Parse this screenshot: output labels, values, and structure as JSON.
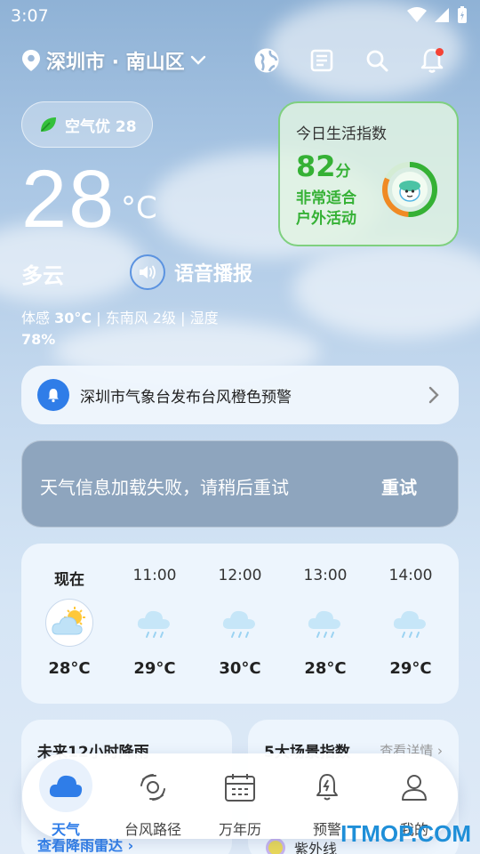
{
  "status_bar": {
    "time": "3:07",
    "icons": [
      "wifi-icon",
      "signal-icon",
      "battery-icon"
    ]
  },
  "location": {
    "name": "深圳市 · 南山区",
    "icon": "location-pin-icon"
  },
  "toolbar_icons": [
    "globe-icon",
    "news-icon",
    "search-icon",
    "bell-icon"
  ],
  "air_quality": {
    "label": "空气优 28",
    "icon": "leaf-icon"
  },
  "current": {
    "temperature": "28",
    "unit": "°C",
    "condition": "多云",
    "voice_label": "语音播报",
    "feels_label": "体感",
    "feels_value": "30°C",
    "sep1": "|",
    "wind": "东南风 2级",
    "sep2": "|",
    "humidity_label": "湿度",
    "humidity_value": "78%"
  },
  "life_index": {
    "title": "今日生活指数",
    "score": "82",
    "score_unit": "分",
    "desc_line1": "非常适合",
    "desc_line2": "户外活动",
    "gauge_fraction": 0.82,
    "colors": {
      "accent": "#35b135",
      "gauge_orange": "#f08a24"
    }
  },
  "alert": {
    "text": "深圳市气象台发布台风橙色预警",
    "icon": "bell-alert-icon"
  },
  "load_error": {
    "message": "天气信息加载失败，请稍后重试",
    "retry": "重试"
  },
  "hourly": [
    {
      "time": "现在",
      "temp": "28°C",
      "icon": "partly-cloudy-icon"
    },
    {
      "time": "11:00",
      "temp": "29°C",
      "icon": "cloud-rain-icon"
    },
    {
      "time": "12:00",
      "temp": "30°C",
      "icon": "cloud-rain-icon"
    },
    {
      "time": "13:00",
      "temp": "28°C",
      "icon": "cloud-rain-icon"
    },
    {
      "time": "14:00",
      "temp": "29°C",
      "icon": "cloud-rain-icon"
    }
  ],
  "rain_card": {
    "title": "未来12小时降雨",
    "link": "查看降雨雷达 ›"
  },
  "index_card": {
    "title": "5大场景指数",
    "link": "查看详情 ›",
    "uv_label": "紫外线"
  },
  "nav": [
    {
      "label": "天气",
      "icon": "cloud-icon",
      "active": true
    },
    {
      "label": "台风路径",
      "icon": "typhoon-icon",
      "active": false
    },
    {
      "label": "万年历",
      "icon": "calendar-icon",
      "active": false
    },
    {
      "label": "预警",
      "icon": "alert-bell-icon",
      "active": false
    },
    {
      "label": "我的",
      "icon": "user-icon",
      "active": false
    }
  ],
  "watermark": "ITMOP.COM",
  "colors": {
    "primary": "#2f7de8",
    "green": "#35b135"
  }
}
